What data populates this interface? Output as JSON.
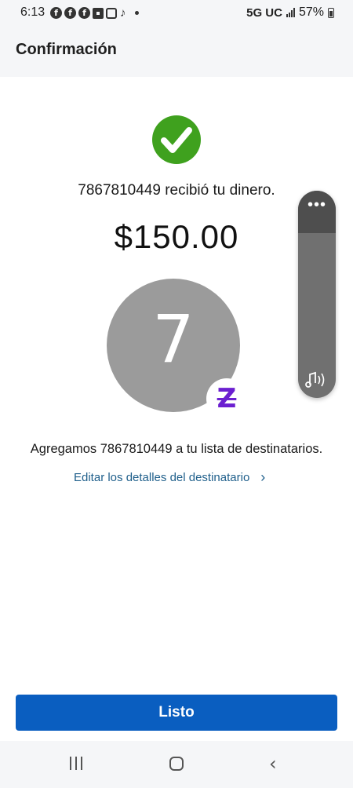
{
  "status_bar": {
    "time": "6:13",
    "network": "5G UC",
    "battery": "57%",
    "icons": [
      "facebook-icon",
      "facebook-icon",
      "facebook-icon",
      "chase-icon",
      "tiktok-icon",
      "notification-dot-icon",
      "signal-icon",
      "battery-icon"
    ]
  },
  "header": {
    "title": "Confirmación"
  },
  "confirmation": {
    "received_text": "7867810449 recibió tu dinero.",
    "amount": "$150.00",
    "check_color": "#3fa11e"
  },
  "recipient": {
    "avatar_initial": "7",
    "avatar_color": "#9b9b9b",
    "badge_letter": "Z",
    "badge_color": "#6b1fd0"
  },
  "info": {
    "added_text": "Agregamos 7867810449 a tu lista de destinatarios.",
    "edit_link": "Editar los detalles del destinatario"
  },
  "actions": {
    "done_label": "Listo",
    "accent": "#0a5ec0"
  },
  "nav": {
    "items": [
      "recents-icon",
      "home-icon",
      "back-icon"
    ]
  }
}
